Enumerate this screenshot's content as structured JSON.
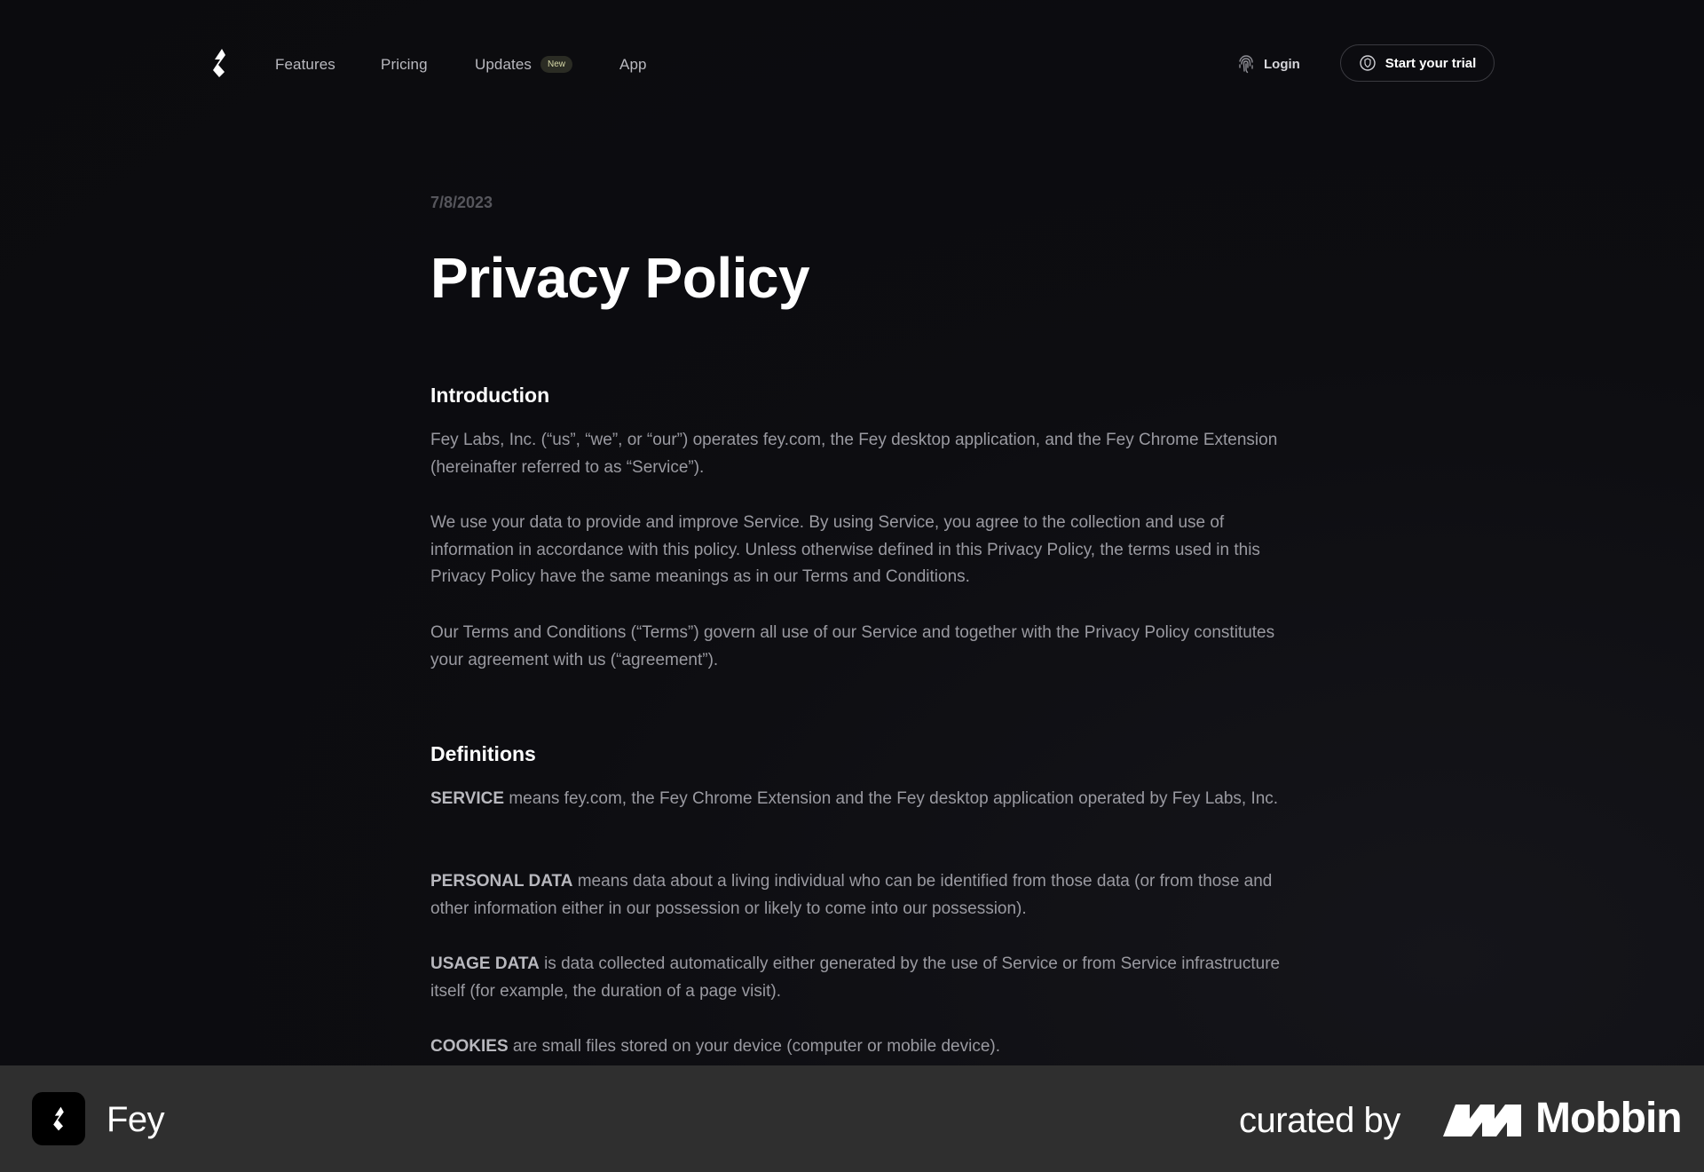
{
  "nav": {
    "logo_icon": "fey-logo-icon",
    "links": [
      "Features",
      "Pricing",
      "Updates",
      "App"
    ],
    "updates_badge": "New",
    "login_label": "Login",
    "trial_label": "Start your trial"
  },
  "article": {
    "date": "7/8/2023",
    "title": "Privacy Policy",
    "intro": {
      "heading": "Introduction",
      "paragraphs": [
        "Fey Labs, Inc. (“us”, “we”, or “our”) operates fey.com, the Fey desktop application, and the Fey Chrome Extension (hereinafter referred to as “Service”).",
        "We use your data to provide and improve Service. By using Service, you agree to the collection and use of information in accordance with this policy. Unless otherwise defined in this Privacy Policy, the terms used in this Privacy Policy have the same meanings as in our Terms and Conditions.",
        "Our Terms and Conditions (“Terms”) govern all use of our Service and together with the Privacy Policy constitutes your agreement with us (“agreement”)."
      ]
    },
    "definitions": {
      "heading": "Definitions",
      "items": [
        {
          "term": "SERVICE",
          "text": " means fey.com, the Fey Chrome Extension and the Fey desktop application operated by Fey Labs, Inc."
        },
        {
          "term": "PERSONAL DATA",
          "text": " means data about a living individual who can be identified from those data (or from those and other information either in our possession or likely to come into our possession)."
        },
        {
          "term": "USAGE DATA",
          "text": " is data collected automatically either generated by the use of Service or from Service infrastructure itself (for example, the duration of a page visit)."
        },
        {
          "term": "COOKIES",
          "text": " are small files stored on your device (computer or mobile device)."
        }
      ]
    }
  },
  "footer": {
    "app_name": "Fey",
    "curated_by": "curated by",
    "brand": "Mobbin"
  },
  "colors": {
    "background": "#0c0c0f",
    "body_text": "#9a9aa1",
    "footer_bg": "#2f2f2f",
    "badge_bg": "#2b2c24",
    "badge_text": "#d7d9a8"
  }
}
